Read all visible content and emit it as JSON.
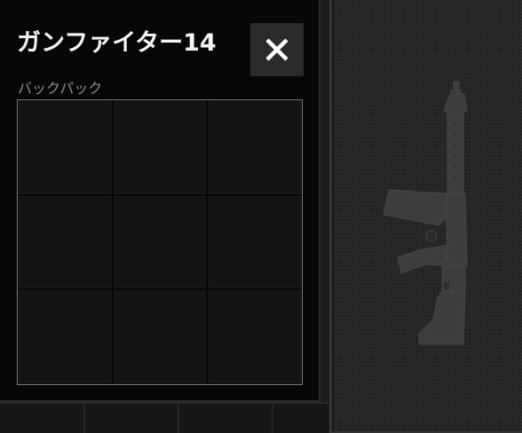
{
  "container": {
    "title": "ガンファイター14",
    "section_label": "バックパック",
    "close_icon": "close-icon",
    "slots": {
      "rows": 3,
      "columns": 3,
      "filled": 0
    }
  },
  "preview": {
    "item_icon": "assault-rifle-icon"
  },
  "colors": {
    "panel_bg": "#070707",
    "title_text": "#f4f4f4",
    "label_text": "#8d8d8d",
    "close_button_bg": "#2a2a2a",
    "preview_bg": "#242424",
    "weapon_silhouette": "#3d3d3d"
  }
}
